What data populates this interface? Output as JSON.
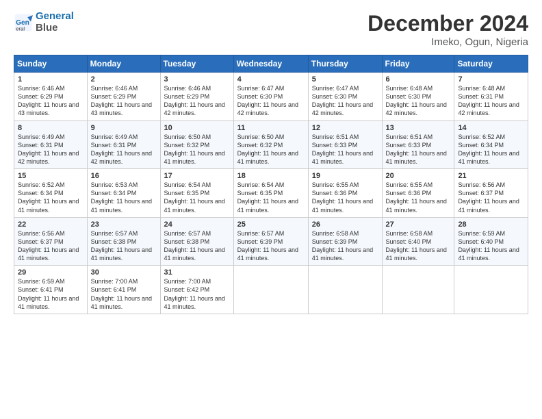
{
  "logo": {
    "line1": "General",
    "line2": "Blue"
  },
  "title": "December 2024",
  "subtitle": "Imeko, Ogun, Nigeria",
  "weekdays": [
    "Sunday",
    "Monday",
    "Tuesday",
    "Wednesday",
    "Thursday",
    "Friday",
    "Saturday"
  ],
  "weeks": [
    [
      {
        "day": "1",
        "sunrise": "6:46 AM",
        "sunset": "6:29 PM",
        "daylight": "11 hours and 43 minutes."
      },
      {
        "day": "2",
        "sunrise": "6:46 AM",
        "sunset": "6:29 PM",
        "daylight": "11 hours and 43 minutes."
      },
      {
        "day": "3",
        "sunrise": "6:46 AM",
        "sunset": "6:29 PM",
        "daylight": "11 hours and 42 minutes."
      },
      {
        "day": "4",
        "sunrise": "6:47 AM",
        "sunset": "6:30 PM",
        "daylight": "11 hours and 42 minutes."
      },
      {
        "day": "5",
        "sunrise": "6:47 AM",
        "sunset": "6:30 PM",
        "daylight": "11 hours and 42 minutes."
      },
      {
        "day": "6",
        "sunrise": "6:48 AM",
        "sunset": "6:30 PM",
        "daylight": "11 hours and 42 minutes."
      },
      {
        "day": "7",
        "sunrise": "6:48 AM",
        "sunset": "6:31 PM",
        "daylight": "11 hours and 42 minutes."
      }
    ],
    [
      {
        "day": "8",
        "sunrise": "6:49 AM",
        "sunset": "6:31 PM",
        "daylight": "11 hours and 42 minutes."
      },
      {
        "day": "9",
        "sunrise": "6:49 AM",
        "sunset": "6:31 PM",
        "daylight": "11 hours and 42 minutes."
      },
      {
        "day": "10",
        "sunrise": "6:50 AM",
        "sunset": "6:32 PM",
        "daylight": "11 hours and 41 minutes."
      },
      {
        "day": "11",
        "sunrise": "6:50 AM",
        "sunset": "6:32 PM",
        "daylight": "11 hours and 41 minutes."
      },
      {
        "day": "12",
        "sunrise": "6:51 AM",
        "sunset": "6:33 PM",
        "daylight": "11 hours and 41 minutes."
      },
      {
        "day": "13",
        "sunrise": "6:51 AM",
        "sunset": "6:33 PM",
        "daylight": "11 hours and 41 minutes."
      },
      {
        "day": "14",
        "sunrise": "6:52 AM",
        "sunset": "6:34 PM",
        "daylight": "11 hours and 41 minutes."
      }
    ],
    [
      {
        "day": "15",
        "sunrise": "6:52 AM",
        "sunset": "6:34 PM",
        "daylight": "11 hours and 41 minutes."
      },
      {
        "day": "16",
        "sunrise": "6:53 AM",
        "sunset": "6:34 PM",
        "daylight": "11 hours and 41 minutes."
      },
      {
        "day": "17",
        "sunrise": "6:54 AM",
        "sunset": "6:35 PM",
        "daylight": "11 hours and 41 minutes."
      },
      {
        "day": "18",
        "sunrise": "6:54 AM",
        "sunset": "6:35 PM",
        "daylight": "11 hours and 41 minutes."
      },
      {
        "day": "19",
        "sunrise": "6:55 AM",
        "sunset": "6:36 PM",
        "daylight": "11 hours and 41 minutes."
      },
      {
        "day": "20",
        "sunrise": "6:55 AM",
        "sunset": "6:36 PM",
        "daylight": "11 hours and 41 minutes."
      },
      {
        "day": "21",
        "sunrise": "6:56 AM",
        "sunset": "6:37 PM",
        "daylight": "11 hours and 41 minutes."
      }
    ],
    [
      {
        "day": "22",
        "sunrise": "6:56 AM",
        "sunset": "6:37 PM",
        "daylight": "11 hours and 41 minutes."
      },
      {
        "day": "23",
        "sunrise": "6:57 AM",
        "sunset": "6:38 PM",
        "daylight": "11 hours and 41 minutes."
      },
      {
        "day": "24",
        "sunrise": "6:57 AM",
        "sunset": "6:38 PM",
        "daylight": "11 hours and 41 minutes."
      },
      {
        "day": "25",
        "sunrise": "6:57 AM",
        "sunset": "6:39 PM",
        "daylight": "11 hours and 41 minutes."
      },
      {
        "day": "26",
        "sunrise": "6:58 AM",
        "sunset": "6:39 PM",
        "daylight": "11 hours and 41 minutes."
      },
      {
        "day": "27",
        "sunrise": "6:58 AM",
        "sunset": "6:40 PM",
        "daylight": "11 hours and 41 minutes."
      },
      {
        "day": "28",
        "sunrise": "6:59 AM",
        "sunset": "6:40 PM",
        "daylight": "11 hours and 41 minutes."
      }
    ],
    [
      {
        "day": "29",
        "sunrise": "6:59 AM",
        "sunset": "6:41 PM",
        "daylight": "11 hours and 41 minutes."
      },
      {
        "day": "30",
        "sunrise": "7:00 AM",
        "sunset": "6:41 PM",
        "daylight": "11 hours and 41 minutes."
      },
      {
        "day": "31",
        "sunrise": "7:00 AM",
        "sunset": "6:42 PM",
        "daylight": "11 hours and 41 minutes."
      },
      null,
      null,
      null,
      null
    ]
  ],
  "labels": {
    "sunrise": "Sunrise: ",
    "sunset": "Sunset: ",
    "daylight": "Daylight: "
  }
}
